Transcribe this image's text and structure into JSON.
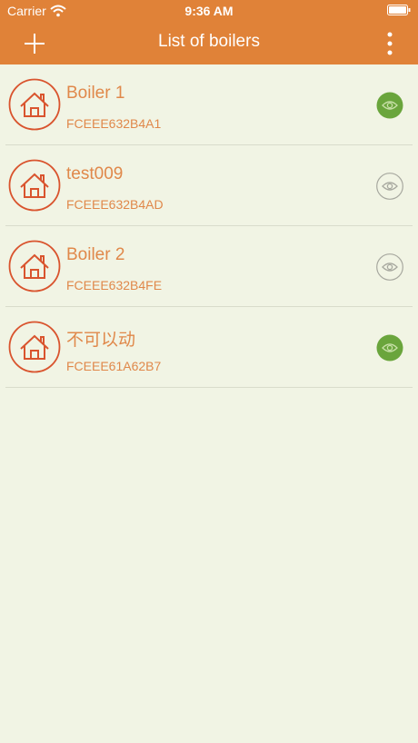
{
  "status_bar": {
    "carrier": "Carrier",
    "time": "9:36 AM"
  },
  "navbar": {
    "title": "List of boilers",
    "add_icon": "plus-icon",
    "menu_icon": "more-vertical-icon"
  },
  "colors": {
    "header": "#e08238",
    "background": "#f1f4e4",
    "accent_text": "#e0884a",
    "icon_stroke": "#d9542e",
    "eye_active_fill": "#6aa53c",
    "eye_inactive_stroke": "#a7a89f"
  },
  "boilers": [
    {
      "name": "Boiler 1",
      "code": "FCEEE632B4A1",
      "visible": true
    },
    {
      "name": "test009",
      "code": "FCEEE632B4AD",
      "visible": false
    },
    {
      "name": "Boiler 2",
      "code": "FCEEE632B4FE",
      "visible": false
    },
    {
      "name": "不可以动",
      "code": "FCEEE61A62B7",
      "visible": true
    }
  ]
}
